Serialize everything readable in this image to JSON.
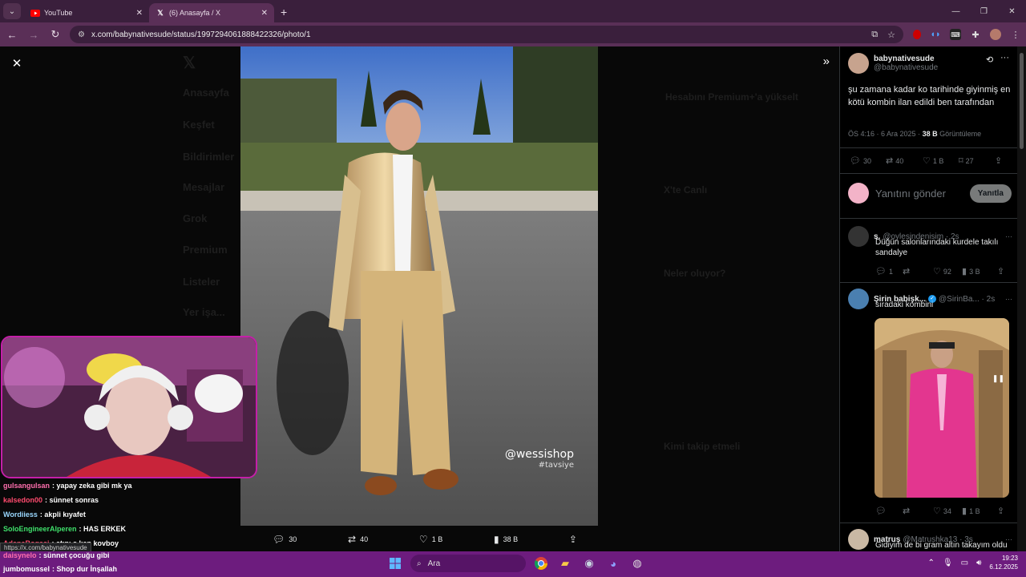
{
  "browser": {
    "tabs": [
      {
        "title": "YouTube",
        "active": false,
        "icon": "youtube-icon"
      },
      {
        "title": "(6) Anasayfa / X",
        "active": true,
        "icon": "x-logo-icon"
      }
    ],
    "url": "x.com/babynativesude/status/1997294061888422326/photo/1",
    "status_url": "https://x.com/babynativesude"
  },
  "viewer": {
    "watermark": "@wessishop",
    "watermark_sub": "#tavsiye",
    "stats": {
      "replies": "30",
      "reposts": "40",
      "likes": "1 B",
      "views": "38 B"
    }
  },
  "background_nav": [
    "Anasayfa",
    "Keşfet",
    "Bildirimler",
    "Mesajlar",
    "Grok",
    "Premium",
    "Listeler",
    "Yer işa..."
  ],
  "background_right": {
    "premium_title": "Hesabını Premium+'a yükselt",
    "live_title": "X'te Canlı",
    "trends_title": "Neler oluyor?",
    "follow_title": "Kimi takip etmeli"
  },
  "chat": [
    {
      "user": "gulsangulsan",
      "msg": ": yapay zeka gibi mk ya",
      "color": "#ff6fae"
    },
    {
      "user": "kalsedon00",
      "msg": ": sünnet sonras",
      "color": "#ff4b6e"
    },
    {
      "user": "Wordiiess",
      "msg": ": akpli kıyafet",
      "color": "#9ad8ff"
    },
    {
      "user": "SoloEngineerAlperen",
      "msg": ": HAS ERKEK",
      "color": "#3fe06b"
    },
    {
      "user": "AdanaBogasi",
      "msg": ": atını s.ken kovboy",
      "color": "#ff4b6e"
    },
    {
      "user": "daisynelo",
      "msg": ": sünnet çocuğu gibi",
      "color": "#ff6fae"
    },
    {
      "user": "jumbomussel",
      "msg": ": Shop dur İnşallah",
      "color": "#ffffff"
    }
  ],
  "tweet": {
    "name": "babynativesude",
    "handle": "@babynativesude",
    "text": "şu zamana kadar ko tarihinde giyinmiş en kötü kombin ilan edildi ben tarafından",
    "time": "ÖS 4:16 · 6 Ara 2025 ·",
    "views": "38 B",
    "views_label": "Görüntüleme",
    "replies": "30",
    "reposts": "40",
    "likes": "1 B",
    "bookmarks": "27"
  },
  "reply_box": {
    "placeholder": "Yanıtını gönder",
    "button": "Yanıtla"
  },
  "replies": [
    {
      "name": "s.",
      "handle": "@oylesindenisim · 2s",
      "text": "Düğün salonlarındaki kurdele takılı sandalye",
      "replies": "1",
      "likes": "92",
      "views": "3 B"
    },
    {
      "name": "Şirin babişk...",
      "handle": "@SirinBa... · 2s",
      "text": "sıradaki kombini",
      "likes": "34",
      "views": "1 B"
    },
    {
      "name": "matruş",
      "handle": "@Matrushka13 · 3s",
      "text": "Gidiyim de bi gram altın takayım oldu"
    }
  ],
  "taskbar": {
    "search": "Ara",
    "time": "19:23",
    "date": "6.12.2025"
  }
}
